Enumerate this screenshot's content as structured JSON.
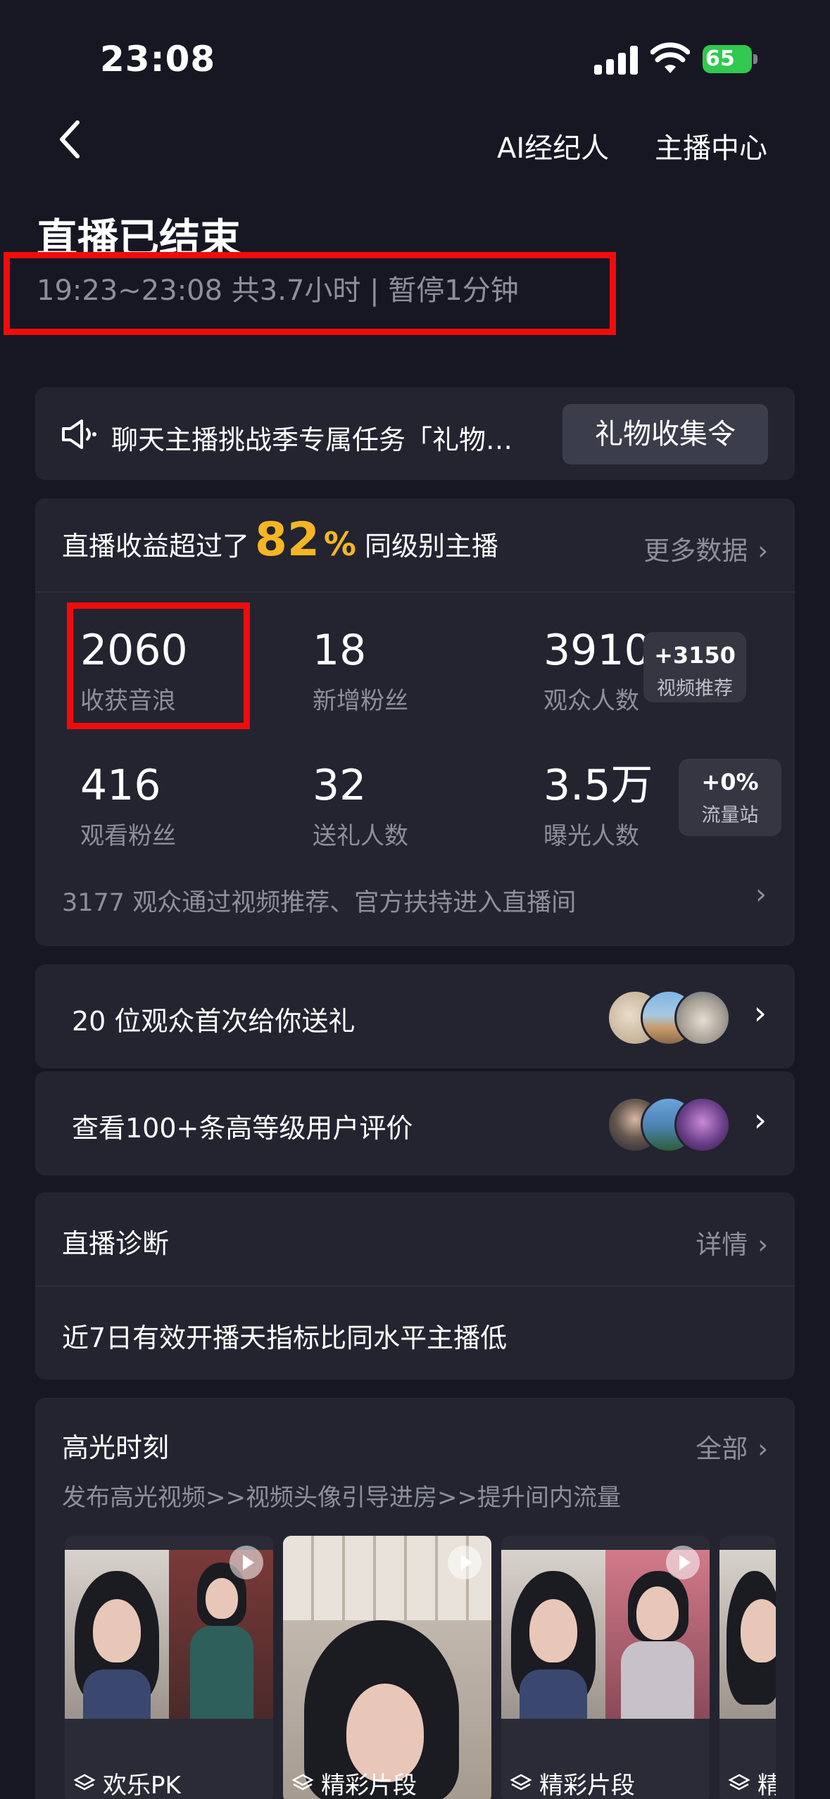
{
  "status_bar": {
    "time": "23:08",
    "battery": "65"
  },
  "nav": {
    "ai_agent": "AI经纪人",
    "anchor_center": "主播中心"
  },
  "title": "直播已结束",
  "subtitle": "19:23~23:08 共3.7小时 | 暂停1分钟",
  "notice": {
    "text": "聊天主播挑战季专属任务「礼物…",
    "button": "礼物收集令"
  },
  "stats": {
    "header_prefix": "直播收益超过了",
    "header_value": "82",
    "header_unit": "%",
    "header_suffix": "同级别主播",
    "more": "更多数据",
    "metrics": [
      {
        "num": "2060",
        "label": "收获音浪"
      },
      {
        "num": "18",
        "label": "新增粉丝"
      },
      {
        "num": "3910",
        "label": "观众人数"
      },
      {
        "num": "416",
        "label": "观看粉丝"
      },
      {
        "num": "32",
        "label": "送礼人数"
      },
      {
        "num": "3.5万",
        "label": "曝光人数"
      }
    ],
    "tags": [
      {
        "value": "+3150",
        "label": "视频推荐"
      },
      {
        "value": "+0%",
        "label": "流量站"
      }
    ],
    "footer": "3177 观众通过视频推荐、官方扶持进入直播间"
  },
  "rows": [
    {
      "text": "20 位观众首次给你送礼"
    },
    {
      "text": "查看100+条高等级用户评价"
    }
  ],
  "diagnosis": {
    "title": "直播诊断",
    "more": "详情",
    "body": "近7日有效开播天指标比同水平主播低"
  },
  "highlights": {
    "title": "高光时刻",
    "more": "全部",
    "subtitle": "发布高光视频>>视频头像引导进房>>提升间内流量",
    "items": [
      {
        "label": "欢乐PK"
      },
      {
        "label": "精彩片段"
      },
      {
        "label": "精彩片段"
      },
      {
        "label": "精"
      }
    ]
  },
  "colors": {
    "background": "#161722",
    "card": "#232430",
    "accent": "#f5b624",
    "highlight_box": "#f00c0c",
    "muted": "#8d8f9a"
  },
  "icons": [
    "signal-icon",
    "wifi-icon",
    "battery-icon",
    "back-icon",
    "speaker-icon",
    "chevron-right-icon",
    "play-icon",
    "layers-icon"
  ]
}
